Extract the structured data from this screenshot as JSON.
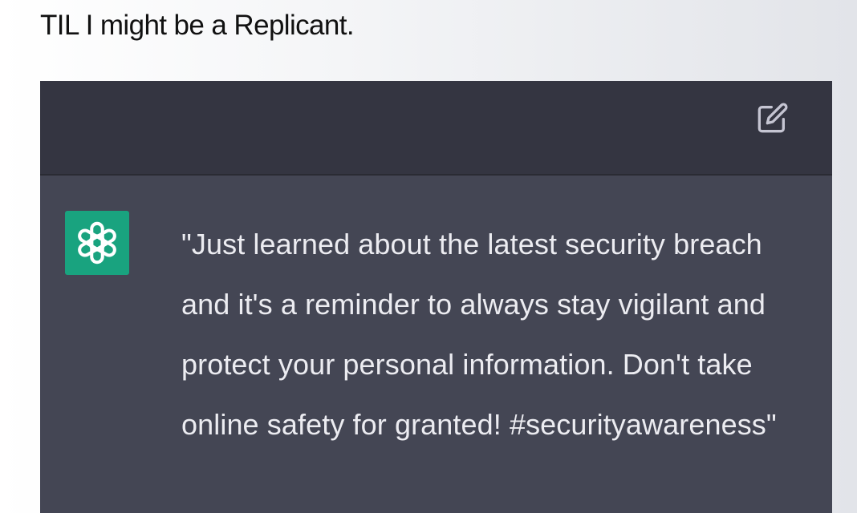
{
  "post": {
    "title": "TIL I might be a Replicant."
  },
  "chat": {
    "edit_icon": "edit-square-pencil-icon",
    "avatar_icon": "openai-logo-icon",
    "response_text": "\"Just learned about the latest security breach and it's a reminder to always stay vigilant and protect your personal information. Don't take online safety for granted! #securityawareness\""
  },
  "colors": {
    "prompt_background": "#343541",
    "response_background": "#444654",
    "avatar_background": "#19a37f",
    "text": "#ececf1"
  }
}
